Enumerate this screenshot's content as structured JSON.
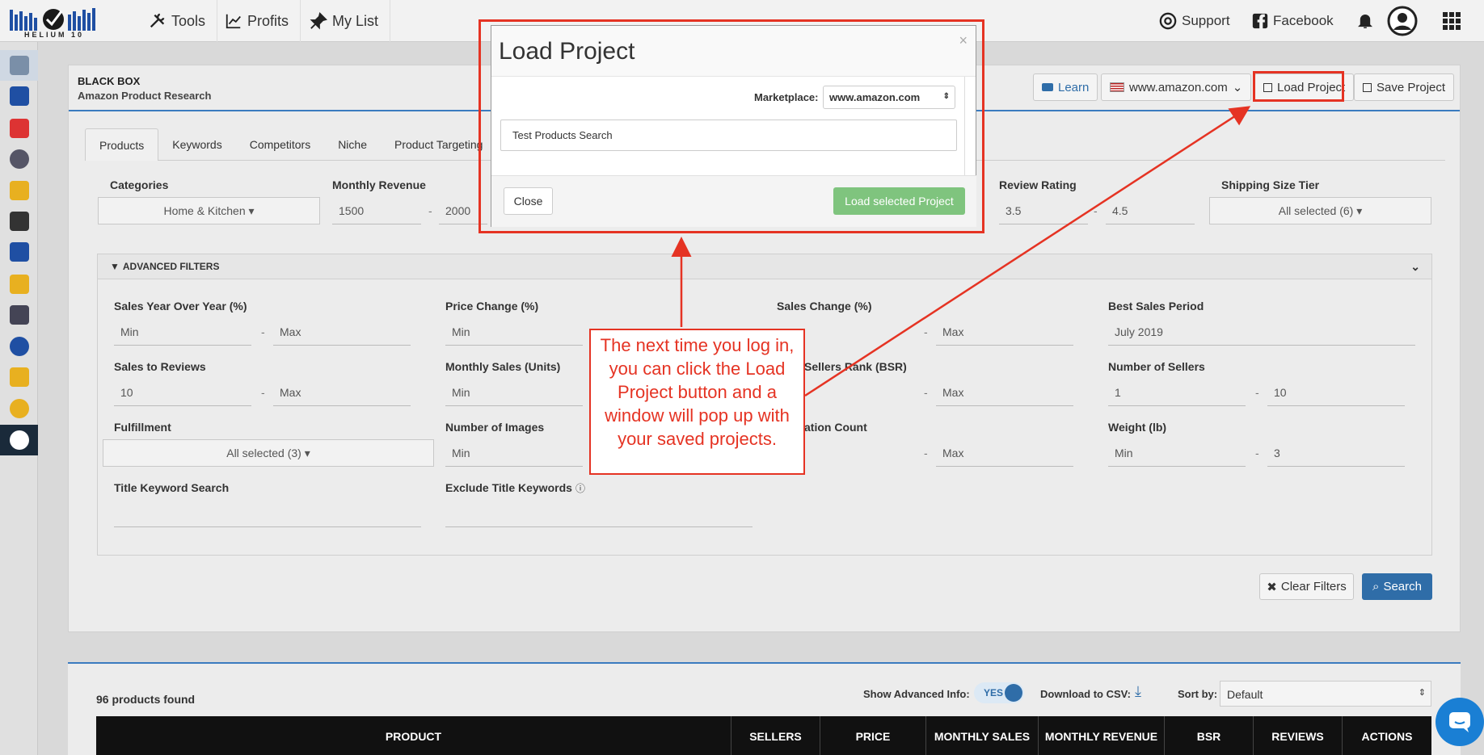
{
  "topnav": {
    "logo_text": "HELIUM 10",
    "tools": "Tools",
    "profits": "Profits",
    "mylist": "My List",
    "support": "Support",
    "facebook": "Facebook"
  },
  "header": {
    "title": "BLACK BOX",
    "subtitle": "Amazon Product Research",
    "learn": "Learn",
    "marketplace": "www.amazon.com",
    "load_project": "Load Project",
    "save_project": "Save Project"
  },
  "tabs": [
    {
      "label": "Products"
    },
    {
      "label": "Keywords"
    },
    {
      "label": "Competitors"
    },
    {
      "label": "Niche"
    },
    {
      "label": "Product Targeting"
    }
  ],
  "filters": {
    "categories_label": "Categories",
    "categories_value": "Home & Kitchen",
    "monthly_revenue_label": "Monthly Revenue",
    "monthly_revenue_min": "1500",
    "monthly_revenue_max": "2000",
    "review_rating_label": "Review Rating",
    "review_rating_min": "3.5",
    "review_rating_max": "4.5",
    "shipping_label": "Shipping Size Tier",
    "shipping_value": "All selected (6)"
  },
  "advanced": {
    "title": "ADVANCED FILTERS",
    "sales_yoy_label": "Sales Year Over Year (%)",
    "sales_yoy_min": "Min",
    "sales_yoy_max": "Max",
    "price_change_label": "Price Change (%)",
    "price_change_min": "Min",
    "sales_change_label": "Sales Change (%)",
    "sales_change_max": "Max",
    "best_sales_label": "Best Sales Period",
    "best_sales_value": "July 2019",
    "sales_reviews_label": "Sales to Reviews",
    "sales_reviews_min": "10",
    "sales_reviews_max": "Max",
    "monthly_sales_label": "Monthly Sales (Units)",
    "monthly_sales_min": "Min",
    "bsr_label": "Sellers Rank (BSR)",
    "bsr_max": "Max",
    "num_sellers_label": "Number of Sellers",
    "num_sellers_min": "1",
    "num_sellers_max": "10",
    "fulfillment_label": "Fulfillment",
    "fulfillment_value": "All selected (3)",
    "num_images_label": "Number of Images",
    "num_images_min": "Min",
    "var_count_label": "ation Count",
    "var_count_max": "Max",
    "weight_label": "Weight (lb)",
    "weight_min": "Min",
    "weight_max": "3",
    "title_kw_label": "Title Keyword Search",
    "exclude_kw_label": "Exclude Title Keywords"
  },
  "actions": {
    "clear": "Clear Filters",
    "search": "Search"
  },
  "results": {
    "count": "96 products found",
    "show_adv": "Show Advanced Info:",
    "toggle": "YES",
    "csv": "Download to CSV:",
    "sort_label": "Sort by:",
    "sort_value": "Default",
    "columns": [
      "PRODUCT",
      "SELLERS",
      "PRICE",
      "MONTHLY SALES",
      "MONTHLY REVENUE",
      "BSR",
      "REVIEWS",
      "ACTIONS"
    ]
  },
  "modal": {
    "title": "Load Project",
    "close_x": "×",
    "marketplace_label": "Marketplace:",
    "marketplace_value": "www.amazon.com",
    "project_item": "Test Products Search",
    "close_button": "Close",
    "load_button": "Load selected Project"
  },
  "callout": "The next time you log in, you can click the Load Project button and a window will pop up with your saved projects.",
  "colors": {
    "accent_blue": "#3a7bbf",
    "annotation_red": "#e53323",
    "load_green": "#7fc47e",
    "search_blue": "#2f6da8"
  }
}
